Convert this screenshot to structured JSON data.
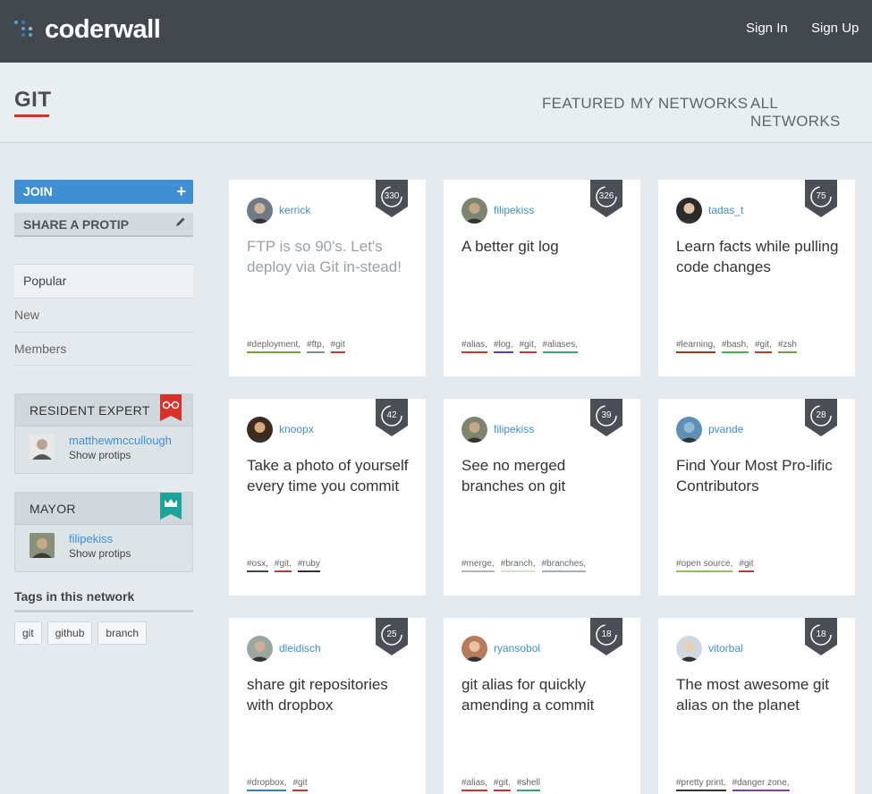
{
  "app": {
    "name": "coderwall"
  },
  "topnav": {
    "sign_in": "Sign In",
    "sign_up": "Sign Up"
  },
  "header": {
    "title": "GIT",
    "nav": [
      "FEATURED",
      "MY NETWORKS",
      "ALL NETWORKS"
    ]
  },
  "sidebar": {
    "join_label": "JOIN",
    "join_icon": "plus-icon",
    "share_label": "SHARE A PROTIP",
    "share_icon": "pencil-icon",
    "items": [
      {
        "label": "Popular",
        "active": true
      },
      {
        "label": "New",
        "active": false
      },
      {
        "label": "Members",
        "active": false
      }
    ],
    "resident_expert": {
      "heading": "RESIDENT EXPERT",
      "name": "matthewmccullough",
      "sub": "Show protips",
      "icon": "glasses-icon",
      "color": "#d9312a"
    },
    "mayor": {
      "heading": "MAYOR",
      "name": "filipekiss",
      "sub": "Show protips",
      "icon": "crown-icon",
      "color": "#1aa59a"
    },
    "tags_title": "Tags in this network",
    "tags": [
      "git",
      "github",
      "branch"
    ]
  },
  "protips": [
    {
      "author": "kerrick",
      "score": "330",
      "title": "FTP is so 90's. Let's deploy via Git in-stead!",
      "faded": true,
      "tags": [
        {
          "label": "#deployment,",
          "color": "#72a33a"
        },
        {
          "label": "#ftp,",
          "color": "#7a8a99"
        },
        {
          "label": "#git",
          "color": "#c5372f"
        }
      ]
    },
    {
      "author": "filipekiss",
      "score": "326",
      "title": "A better git log",
      "faded": false,
      "tags": [
        {
          "label": "#alias,",
          "color": "#c5372f"
        },
        {
          "label": "#log,",
          "color": "#5a3fa6"
        },
        {
          "label": "#git,",
          "color": "#c5372f"
        },
        {
          "label": "#aliases,",
          "color": "#3aa76d"
        }
      ]
    },
    {
      "author": "tadas_t",
      "score": "75",
      "title": "Learn facts while pulling code changes",
      "faded": false,
      "tags": [
        {
          "label": "#learning,",
          "color": "#a0341f"
        },
        {
          "label": "#bash,",
          "color": "#3cb54a"
        },
        {
          "label": "#git,",
          "color": "#c5372f"
        },
        {
          "label": "#zsh",
          "color": "#6aa04a"
        }
      ]
    },
    {
      "author": "knoopx",
      "score": "42",
      "title": "Take a photo of yourself every time you commit",
      "faded": false,
      "tags": [
        {
          "label": "#osx,",
          "color": "#34495e"
        },
        {
          "label": "#git,",
          "color": "#c5372f"
        },
        {
          "label": "#ruby",
          "color": "#333333"
        }
      ]
    },
    {
      "author": "filipekiss",
      "score": "39",
      "title": "See no merged branches on git",
      "faded": false,
      "tags": [
        {
          "label": "#merge,",
          "color": "#aeb7bd"
        },
        {
          "label": "#branch,",
          "color": "#cde8c4"
        },
        {
          "label": "#branches,",
          "color": "#9fb0bf"
        }
      ]
    },
    {
      "author": "pvande",
      "score": "28",
      "title": "Find Your Most Pro-lific Contributors",
      "faded": false,
      "tags": [
        {
          "label": "#open source,",
          "color": "#8cc63e"
        },
        {
          "label": "#git",
          "color": "#c5372f"
        }
      ]
    },
    {
      "author": "dleidisch",
      "score": "25",
      "title": "share git repositories with dropbox",
      "faded": false,
      "tags": [
        {
          "label": "#dropbox,",
          "color": "#3a7cc4"
        },
        {
          "label": "#git",
          "color": "#c5372f"
        }
      ]
    },
    {
      "author": "ryansobol",
      "score": "18",
      "title": "git alias for quickly amending a commit",
      "faded": false,
      "tags": [
        {
          "label": "#alias,",
          "color": "#c5372f"
        },
        {
          "label": "#git,",
          "color": "#c5372f"
        },
        {
          "label": "#shell",
          "color": "#3aa76d"
        }
      ]
    },
    {
      "author": "vitorbal",
      "score": "18",
      "title": "The most awesome git alias on the planet",
      "faded": false,
      "tags": [
        {
          "label": "#pretty print,",
          "color": "#333333"
        },
        {
          "label": "#danger zone,",
          "color": "#7e3fa6"
        }
      ]
    }
  ]
}
